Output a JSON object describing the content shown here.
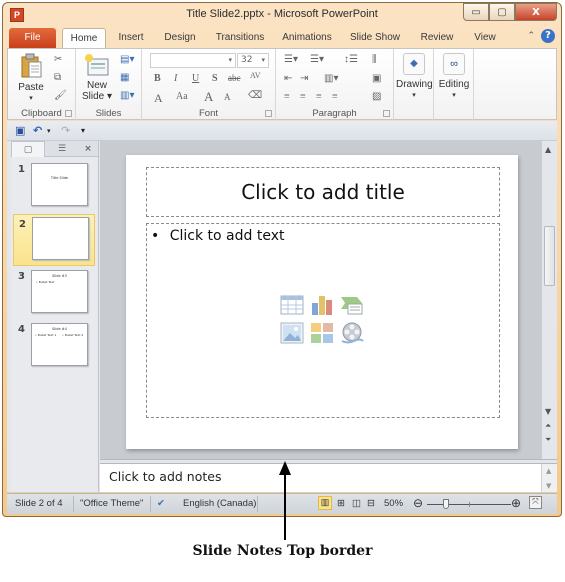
{
  "window": {
    "title": "Title Slide2.pptx - Microsoft PowerPoint",
    "app_icon": "P",
    "controls": {
      "minimize": "▭",
      "maximize": "▢",
      "close": "X"
    }
  },
  "tabs": [
    {
      "label": "File"
    },
    {
      "label": "Home",
      "active": true
    },
    {
      "label": "Insert"
    },
    {
      "label": "Design"
    },
    {
      "label": "Transitions"
    },
    {
      "label": "Animations"
    },
    {
      "label": "Slide Show"
    },
    {
      "label": "Review"
    },
    {
      "label": "View"
    }
  ],
  "help_icon": "?",
  "collapse_icon": "⌃",
  "ribbon": {
    "clipboard": {
      "label": "Clipboard",
      "paste": "Paste"
    },
    "slides": {
      "label": "Slides",
      "new_slide_line1": "New",
      "new_slide_line2": "Slide ▾"
    },
    "font": {
      "label": "Font",
      "font_name": "",
      "font_size": "32",
      "bold": "B",
      "italic": "I",
      "underline": "U",
      "shadow": "S",
      "strikethrough": "abc",
      "spacing": "AV",
      "color": "A",
      "case": "Aa",
      "grow": "A",
      "shrink": "A"
    },
    "paragraph": {
      "label": "Paragraph"
    },
    "drawing": {
      "label": "Drawing"
    },
    "editing": {
      "label": "Editing"
    }
  },
  "qat": {
    "save": "save",
    "undo": "↶",
    "redo": "↷",
    "customize": "▾"
  },
  "slide_pane": {
    "close": "×",
    "slides": [
      {
        "num": "1",
        "title": "Title Slide",
        "bullets": []
      },
      {
        "num": "2",
        "title": "",
        "bullets": [],
        "selected": true
      },
      {
        "num": "3",
        "title": "Slide #3",
        "bullets": [
          "• Bullet Text"
        ]
      },
      {
        "num": "4",
        "title": "Slide #4",
        "bullets": [
          "• Bullet Text 1",
          "• Bullet Text 2"
        ]
      }
    ]
  },
  "slide": {
    "title_placeholder": "Click to add title",
    "body_placeholder": "Click to add text",
    "bullet": "•",
    "content_icons": [
      "table-icon",
      "chart-icon",
      "smartart-icon",
      "picture-icon",
      "clipart-icon",
      "media-icon"
    ]
  },
  "notes": {
    "placeholder": "Click to add notes"
  },
  "status": {
    "slide_info": "Slide 2 of 4",
    "theme": "\"Office Theme\"",
    "language": "English (Canada)",
    "zoom": "50%",
    "zoom_percent": 50
  },
  "annotation": {
    "label": "Slide Notes Top border"
  }
}
